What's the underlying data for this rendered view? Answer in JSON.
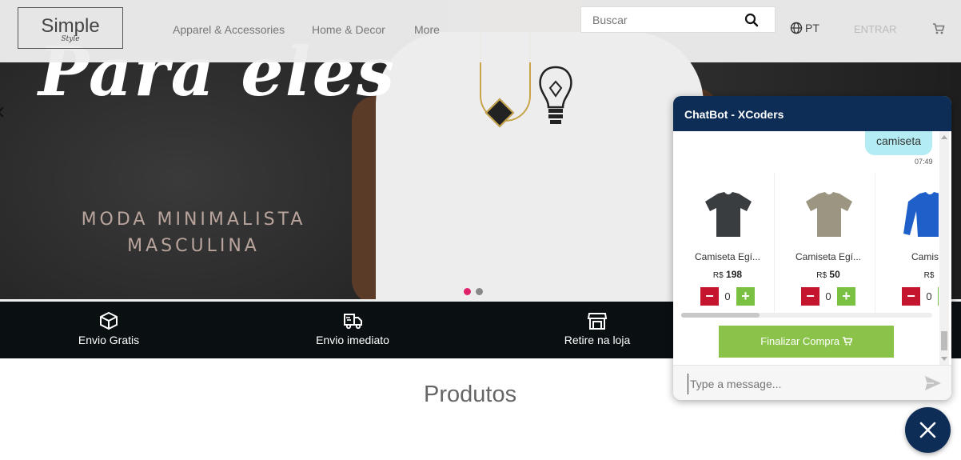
{
  "header": {
    "logo": {
      "main": "Simple",
      "sub": "Style"
    },
    "nav": [
      {
        "label": "Apparel & Accessories"
      },
      {
        "label": "Home & Decor"
      },
      {
        "label": "More"
      }
    ],
    "search": {
      "placeholder": "Buscar"
    },
    "language": "PT",
    "login": "ENTRAR"
  },
  "hero": {
    "script_title": "Para eles",
    "tagline_line1": "MODA MINIMALISTA",
    "tagline_line2": "MASCULINA",
    "slide_dots": 2,
    "active_slide": 1
  },
  "features": [
    {
      "label": "Envio Gratis",
      "icon": "box-icon"
    },
    {
      "label": "Envio imediato",
      "icon": "fast-delivery-truck-icon"
    },
    {
      "label": "Retire na loja",
      "icon": "store-icon"
    }
  ],
  "section_title": "Produtos",
  "chatbot": {
    "title": "ChatBot - XCoders",
    "user_message": "camiseta",
    "message_time": "07:49",
    "products": [
      {
        "name": "Camiseta Egí...",
        "currency": "R$",
        "price": "198",
        "qty": "0",
        "color": "#3a3d40"
      },
      {
        "name": "Camiseta Egí...",
        "currency": "R$",
        "price": "50",
        "qty": "0",
        "color": "#9c9582"
      },
      {
        "name": "Camiset",
        "currency": "R$",
        "price": "",
        "qty": "0",
        "color": "#1f5fc9"
      }
    ],
    "checkout_label": "Finalizar Compra",
    "input_placeholder": "Type a message..."
  },
  "colors": {
    "chat_header": "#0d2d57",
    "checkout_button": "#8bc34a",
    "minus_button": "#c4142e",
    "plus_button": "#7ac143",
    "user_bubble": "#b3ecf3",
    "active_dot": "#e0226a"
  }
}
